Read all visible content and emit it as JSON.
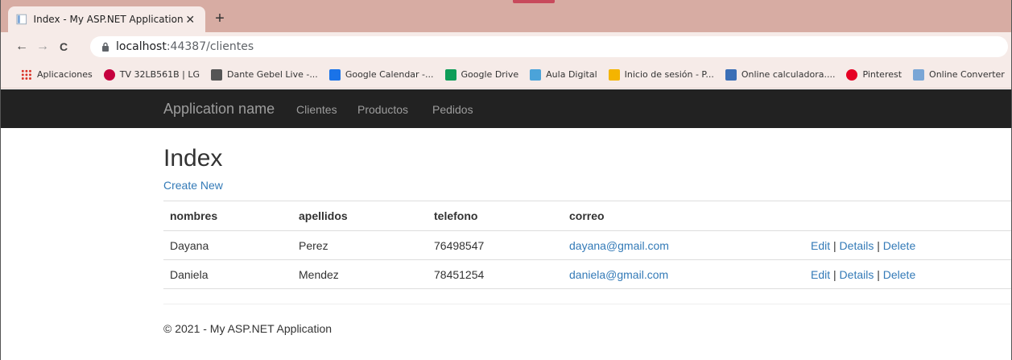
{
  "browser": {
    "tab": {
      "title": "Index - My ASP.NET Application",
      "close": "✕"
    },
    "new_tab": "+",
    "nav": {
      "back": "←",
      "forward": "→",
      "reload": "C"
    },
    "url": {
      "host": "localhost",
      "path": ":44387/clientes"
    },
    "bookmarks": [
      {
        "label": "Aplicaciones",
        "icon": "apps-grid-icon",
        "color": "#d93025"
      },
      {
        "label": "TV 32LB561B | LG",
        "icon": "lg-icon",
        "color": "#c5003e"
      },
      {
        "label": "Dante Gebel Live -...",
        "icon": "dante-icon",
        "color": "#555555"
      },
      {
        "label": "Google Calendar -...",
        "icon": "calendar-icon",
        "color": "#1a73e8"
      },
      {
        "label": "Google Drive",
        "icon": "drive-icon",
        "color": "#0f9d58"
      },
      {
        "label": "Aula Digital",
        "icon": "aula-icon",
        "color": "#4ba3d9"
      },
      {
        "label": "Inicio de sesión - P...",
        "icon": "login-icon",
        "color": "#f4b400"
      },
      {
        "label": "Online calculadora....",
        "icon": "calculator-icon",
        "color": "#3b6fb6"
      },
      {
        "label": "Pinterest",
        "icon": "pinterest-icon",
        "color": "#e60023"
      },
      {
        "label": "Online Converter",
        "icon": "converter-icon",
        "color": "#7aa6d6"
      }
    ]
  },
  "app": {
    "brand": "Application name",
    "nav": [
      "Clientes",
      "Productos",
      "Pedidos"
    ],
    "page_title": "Index",
    "create_link": "Create New",
    "table": {
      "headers": [
        "nombres",
        "apellidos",
        "telefono",
        "correo",
        ""
      ],
      "rows": [
        {
          "nombres": "Dayana",
          "apellidos": "Perez",
          "telefono": "76498547",
          "correo": "dayana@gmail.com"
        },
        {
          "nombres": "Daniela",
          "apellidos": "Mendez",
          "telefono": "78451254",
          "correo": "daniela@gmail.com"
        }
      ],
      "actions": {
        "edit": "Edit",
        "details": "Details",
        "delete": "Delete",
        "sep": " | "
      }
    },
    "footer": "© 2021 - My ASP.NET Application"
  },
  "colors": {
    "link": "#337ab7",
    "navbar": "#222222",
    "navbar_text": "#9d9d9d",
    "tabstrip": "#d7aca3"
  }
}
